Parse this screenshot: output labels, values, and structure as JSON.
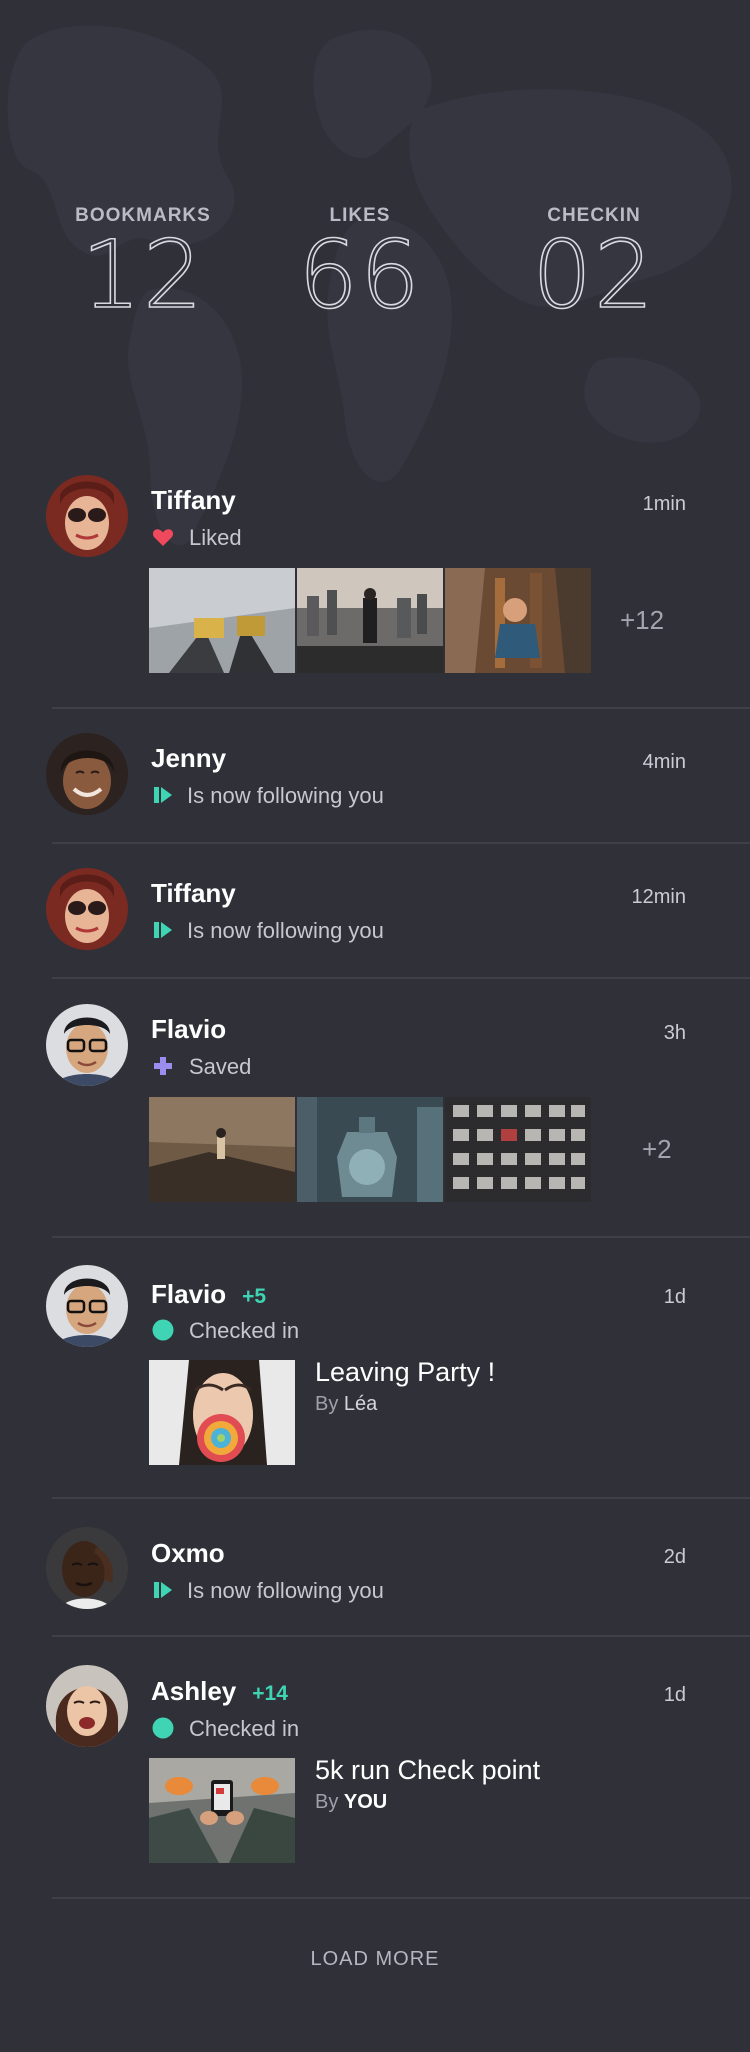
{
  "stats": [
    {
      "label": "BOOKMARKS",
      "value": "12"
    },
    {
      "label": "LIKES",
      "value": "66"
    },
    {
      "label": "CHECKIN",
      "value": "02"
    }
  ],
  "colors": {
    "background": "#2f3038",
    "accent_teal": "#3ed4b4",
    "heart": "#f0485c",
    "saved": "#9b8df0"
  },
  "feed": [
    {
      "name": "Tiffany",
      "time": "1min",
      "action": "Liked",
      "icon": "heart-icon",
      "more": "+12"
    },
    {
      "name": "Jenny",
      "time": "4min",
      "action": "Is now following you",
      "icon": "follow-icon"
    },
    {
      "name": "Tiffany",
      "time": "12min",
      "action": "Is now following you",
      "icon": "follow-icon"
    },
    {
      "name": "Flavio",
      "time": "3h",
      "action": "Saved",
      "icon": "plus-icon",
      "more": "+2"
    },
    {
      "name": "Flavio",
      "extra": "+5",
      "time": "1d",
      "action": "Checked in",
      "icon": "dot-icon",
      "event_title": "Leaving Party !",
      "event_by_prefix": "By",
      "event_by": "Léa"
    },
    {
      "name": "Oxmo",
      "time": "2d",
      "action": "Is now following you",
      "icon": "follow-icon"
    },
    {
      "name": "Ashley",
      "extra": "+14",
      "time": "1d",
      "action": "Checked in",
      "icon": "dot-icon",
      "event_title": "5k run Check point",
      "event_by_prefix": "By",
      "event_by": "YOU"
    }
  ],
  "load_more": "LOAD MORE"
}
